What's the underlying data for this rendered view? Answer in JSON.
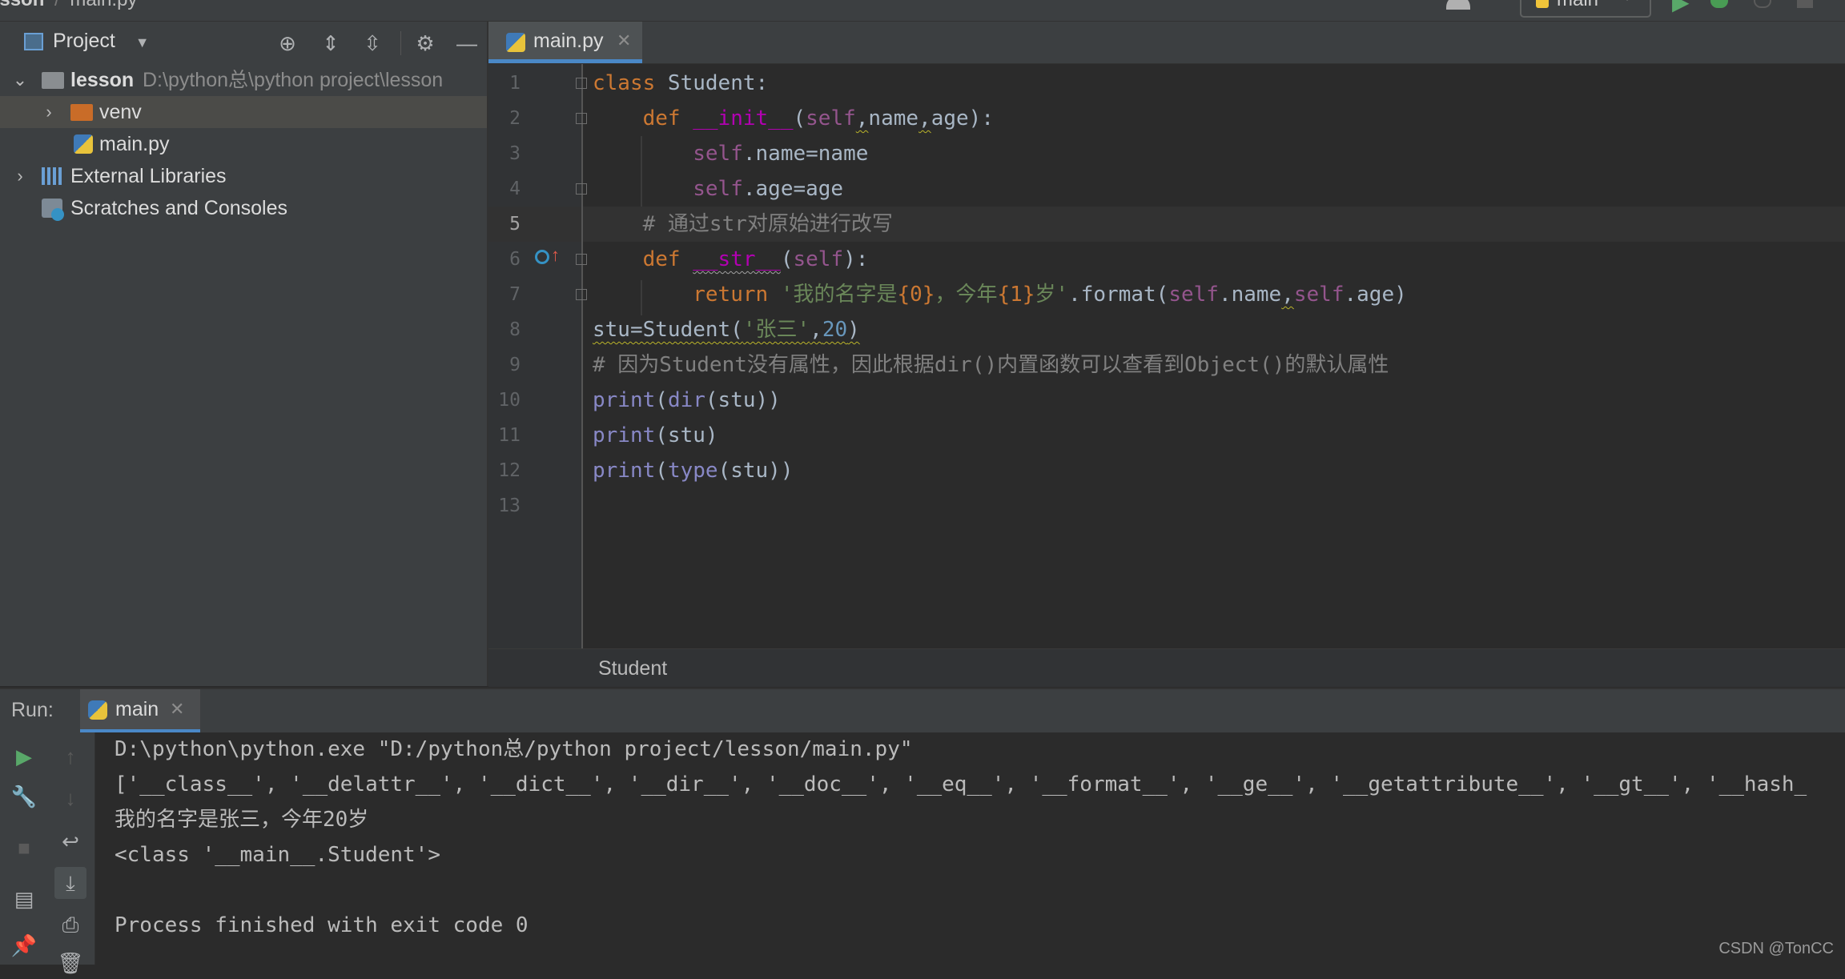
{
  "topbar": {
    "breadcrumb_project": "esson",
    "breadcrumb_sep": "/",
    "breadcrumb_file": "main.py",
    "run_config": "main"
  },
  "project_panel": {
    "title": "Project",
    "tree": [
      {
        "label": "lesson",
        "path": "D:\\python总\\python project\\lesson"
      },
      {
        "label": "venv"
      },
      {
        "label": "main.py"
      },
      {
        "label": "External Libraries"
      },
      {
        "label": "Scratches and Consoles"
      }
    ]
  },
  "editor": {
    "tab_label": "main.py",
    "line_numbers": [
      "1",
      "2",
      "3",
      "4",
      "5",
      "6",
      "7",
      "8",
      "9",
      "10",
      "11",
      "12",
      "13"
    ],
    "current_line": "5",
    "code": {
      "l1": {
        "kw": "class",
        "name": " Student:"
      },
      "l2": {
        "kw": "def",
        "fn": "__init__",
        "p1": "(",
        "self": "self",
        "c1": ",",
        "a1": "name",
        "c2": ",",
        "a2": "age",
        "p2": "):"
      },
      "l3": {
        "self": "self",
        "rest": ".name=name"
      },
      "l4": {
        "self": "self",
        "rest": ".age=age"
      },
      "l5": {
        "comment": "# 通过str对原始进行改写"
      },
      "l6": {
        "kw": "def",
        "fn": "__str__",
        "p1": "(",
        "self": "self",
        "p2": "):"
      },
      "l7": {
        "kw": "return",
        "str_a": "'我的名字是",
        "fmt1": "{0}",
        "str_b": "，今年",
        "fmt2": "{1}",
        "str_c": "岁'",
        "call": ".format(",
        "self1": "self",
        "m1": ".name",
        "comma": ",",
        "self2": "self",
        "m2": ".age)"
      },
      "l8": {
        "a": "stu=Student(",
        "s": "'张三'",
        "c": ",",
        "n": "20",
        "b": ")"
      },
      "l9": {
        "comment": "# 因为Student没有属性，因此根据dir()内置函数可以查看到Object()的默认属性"
      },
      "l10": {
        "print": "print",
        "p": "(",
        "bi": "dir",
        "rest": "(stu))"
      },
      "l11": {
        "print": "print",
        "rest": "(stu)"
      },
      "l12": {
        "print": "print",
        "p": "(",
        "bi": "type",
        "rest": "(stu))"
      }
    },
    "breadcrumb": "Student"
  },
  "run_panel": {
    "label": "Run:",
    "tab": "main",
    "output": [
      "D:\\python\\python.exe \"D:/python总/python project/lesson/main.py\"",
      "['__class__', '__delattr__', '__dict__', '__dir__', '__doc__', '__eq__', '__format__', '__ge__', '__getattribute__', '__gt__', '__hash_",
      "我的名字是张三，今年20岁",
      "<class '__main__.Student'>",
      "",
      "Process finished with exit code 0"
    ]
  },
  "watermark": "CSDN @TonCC",
  "colors": {
    "keyword": "#cc7832",
    "function": "#ffc66d",
    "dunder": "#b200b2",
    "self": "#94558d",
    "string": "#6a8759",
    "number": "#6897bb",
    "comment": "#808080",
    "builtin": "#8888c6",
    "accent": "#4a88c7"
  }
}
